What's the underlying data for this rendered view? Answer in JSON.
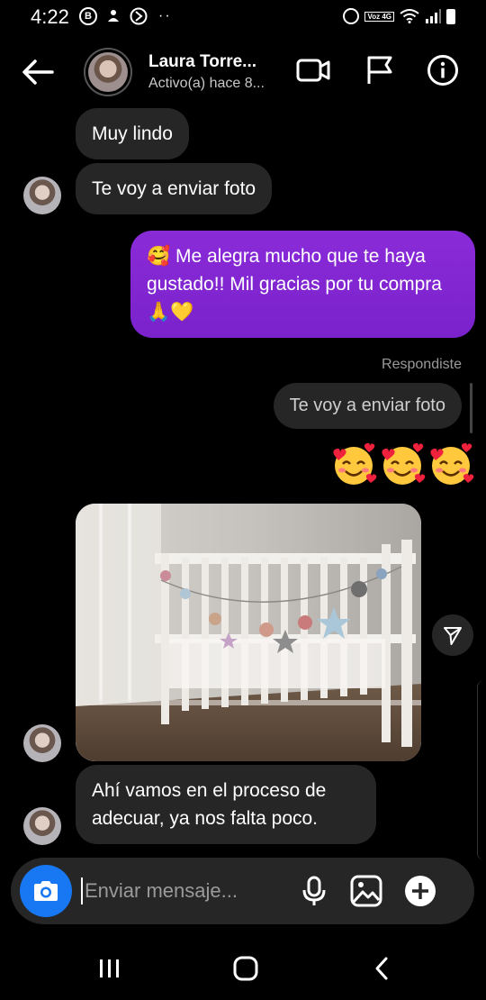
{
  "status_bar": {
    "time": "4:22",
    "badge_b": "B",
    "volte_label": "Voz 4G"
  },
  "header": {
    "contact_name": "Laura Torre...",
    "contact_status": "Activo(a) hace 8..."
  },
  "messages": [
    {
      "id": "m1",
      "direction": "incoming",
      "text": "Muy lindo"
    },
    {
      "id": "m2",
      "direction": "incoming",
      "text": "Te voy a enviar foto"
    },
    {
      "id": "m3",
      "direction": "outgoing",
      "text": "🥰 Me alegra mucho que te haya gustado!! Mil gracias por tu compra 🙏💛"
    },
    {
      "id": "m4",
      "direction": "outgoing",
      "reply_label": "Respondiste",
      "quoted_text": "Te voy a enviar foto",
      "emoji": "🥰🥰🥰"
    },
    {
      "id": "m5",
      "direction": "incoming",
      "type": "photo",
      "subject": "crib-with-crochet-garland"
    },
    {
      "id": "m6",
      "direction": "incoming",
      "text": "Ahí vamos en el proceso de adecuar, ya nos falta poco."
    }
  ],
  "composer": {
    "placeholder": "Enviar mensaje...",
    "icons": [
      "camera-icon",
      "microphone-icon",
      "gallery-icon",
      "add-icon"
    ]
  },
  "nav_bar": {
    "icons": [
      "recents-icon",
      "home-icon",
      "back-icon"
    ]
  },
  "colors": {
    "background": "#000000",
    "incoming_bubble": "#262626",
    "outgoing_bubble": "#7f27d0",
    "camera_button": "#1877f2",
    "muted_text": "#9a9a9a"
  }
}
